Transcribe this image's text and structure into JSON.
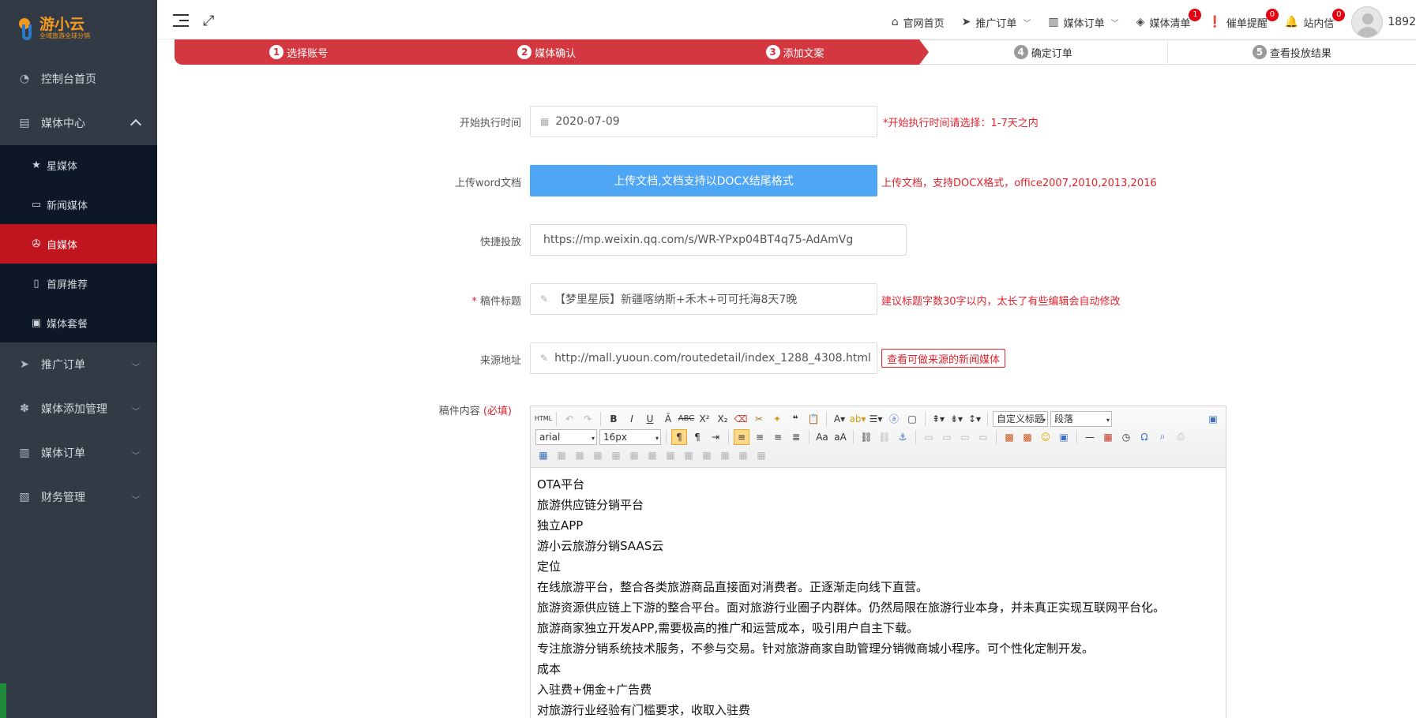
{
  "brand": {
    "name": "游小云",
    "tagline": "全域旅游全球分销"
  },
  "sidebar": {
    "items": [
      {
        "label": "控制台首页",
        "icon": "dashboard-icon"
      },
      {
        "label": "媒体中心",
        "icon": "list-icon"
      },
      {
        "label": "推广订单",
        "icon": "send-icon"
      },
      {
        "label": "媒体添加管理",
        "icon": "paw-icon"
      },
      {
        "label": "媒体订单",
        "icon": "chart-icon"
      },
      {
        "label": "财务管理",
        "icon": "book-icon"
      }
    ],
    "sub_items": [
      {
        "label": "星媒体",
        "icon": "star-icon"
      },
      {
        "label": "新闻媒体",
        "icon": "news-icon"
      },
      {
        "label": "自媒体",
        "icon": "film-icon"
      },
      {
        "label": "首屏推荐",
        "icon": "phone-icon"
      },
      {
        "label": "媒体套餐",
        "icon": "package-icon"
      }
    ],
    "active_sub": "自媒体"
  },
  "header": {
    "links": [
      {
        "label": "官网首页",
        "icon": "home-icon"
      },
      {
        "label": "推广订单",
        "icon": "send-icon"
      },
      {
        "label": "媒体订单",
        "icon": "chart-icon"
      },
      {
        "label": "媒体清单",
        "icon": "layers-icon",
        "badge": "1"
      },
      {
        "label": "催单提醒",
        "icon": "alert-icon",
        "badge": "0"
      },
      {
        "label": "站内信",
        "icon": "bell-icon",
        "badge": "0"
      }
    ],
    "user": "1892"
  },
  "steps": [
    {
      "num": "1",
      "label": "选择账号",
      "done": true
    },
    {
      "num": "2",
      "label": "媒体确认",
      "done": true
    },
    {
      "num": "3",
      "label": "添加文案",
      "done": true
    },
    {
      "num": "4",
      "label": "确定订单",
      "done": false
    },
    {
      "num": "5",
      "label": "查看投放结果",
      "done": false
    }
  ],
  "form": {
    "start_time": {
      "label": "开始执行时间",
      "value": "2020-07-09",
      "hint": "*开始执行时间请选择：1-7天之内"
    },
    "upload": {
      "label": "上传word文档",
      "button": "上传文档,文档支持以DOCX结尾格式",
      "hint": "上传文档，支持DOCX格式，office2007,2010,2013,2016"
    },
    "quick": {
      "label": "快捷投放",
      "value": "https://mp.weixin.qq.com/s/WR-YPxp04BT4q75-AdAmVg"
    },
    "title": {
      "req": "*",
      "label": "稿件标题",
      "value": "【梦里星辰】新疆喀纳斯+禾木+可可托海8天7晚",
      "hint": "建议标题字数30字以内，太长了有些编辑会自动修改"
    },
    "source": {
      "label": "来源地址",
      "value": "http://mall.yuoun.com/routedetail/index_1288_4308.html",
      "button": "查看可做来源的新闻媒体"
    },
    "content": {
      "label": "稿件内容",
      "req": "(必填)"
    }
  },
  "editor": {
    "font": "arial",
    "size": "16px",
    "heading": "自定义标题",
    "para": "段落",
    "lines": [
      "OTA平台",
      "旅游供应链分销平台",
      "独立APP",
      "游小云旅游分销SAAS云",
      "定位",
      "在线旅游平台，整合各类旅游商品直接面对消费者。正逐渐走向线下直营。",
      "旅游资源供应链上下游的整合平台。面对旅游行业圈子内群体。仍然局限在旅游行业本身，并未真正实现互联网平台化。",
      "旅游商家独立开发APP,需要极高的推广和运营成本，吸引用户自主下载。",
      "专注旅游分销系统技术服务，不参与交易。针对旅游商家自助管理分销微商城小程序。可个性化定制开发。",
      "成本",
      "入驻费+佣金+广告费",
      "对旅游行业经验有门槛要求，收取入驻费"
    ]
  }
}
